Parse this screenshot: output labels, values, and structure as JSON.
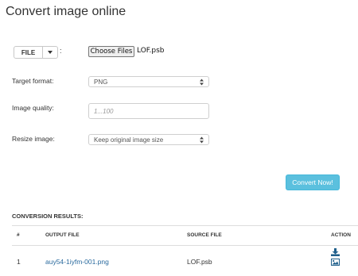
{
  "page": {
    "title": "Convert image online"
  },
  "source": {
    "button_label": "FILE",
    "colon": ":"
  },
  "file_input": {
    "button_label": "Choose Files",
    "file_name": "LOF.psb"
  },
  "target_format": {
    "label": "Target format:",
    "value": "PNG"
  },
  "image_quality": {
    "label": "Image quality:",
    "placeholder": "1...100"
  },
  "resize_image": {
    "label": "Resize image:",
    "value": "Keep original image size"
  },
  "convert_button": {
    "label": "Convert Now!",
    "color": "#5bc0de"
  },
  "results": {
    "heading": "CONVERSION RESULTS:",
    "columns": [
      "#",
      "OUTPUT FILE",
      "SOURCE FILE",
      "ACTION"
    ],
    "rows": [
      {
        "number": "1",
        "output_file": "auy54-1iyfm-001.png",
        "source_file": "LOF.psb",
        "actions": [
          "download-icon",
          "image-icon"
        ]
      }
    ]
  },
  "colors": {
    "link": "#2a6a9e",
    "accent": "#5bc0de",
    "icon": "#1f5f8b"
  }
}
